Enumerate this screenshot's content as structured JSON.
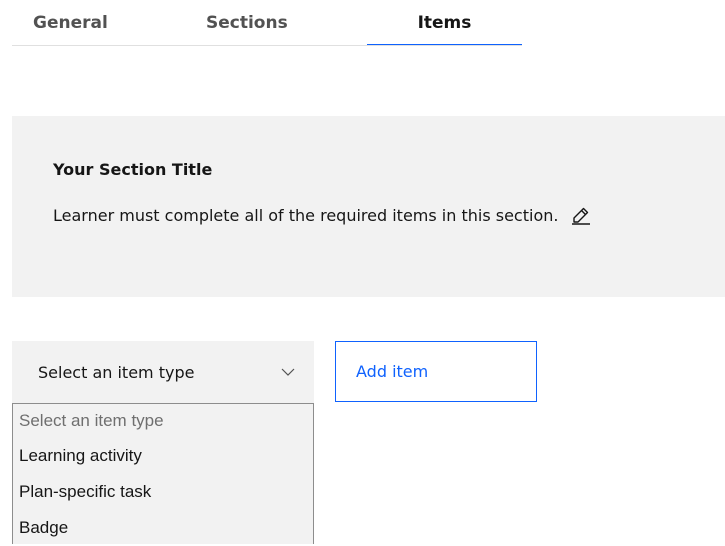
{
  "tabs": [
    {
      "label": "General"
    },
    {
      "label": "Sections"
    },
    {
      "label": "Items"
    }
  ],
  "active_tab": "Items",
  "section": {
    "title": "Your Section Title",
    "description": "Learner must complete all of the required items in this section."
  },
  "item_type_select": {
    "value": "Select an item type",
    "options": [
      {
        "label": "Select an item type"
      },
      {
        "label": "Learning activity"
      },
      {
        "label": "Plan-specific task"
      },
      {
        "label": "Badge"
      }
    ]
  },
  "add_button": {
    "label": "Add item"
  },
  "colors": {
    "accent": "#0f62fe",
    "panel_bg": "#f2f2f2",
    "text": "#161616",
    "muted": "#525252"
  },
  "icons": {
    "edit": "pencil-icon",
    "select": "chevron-down-icon"
  }
}
